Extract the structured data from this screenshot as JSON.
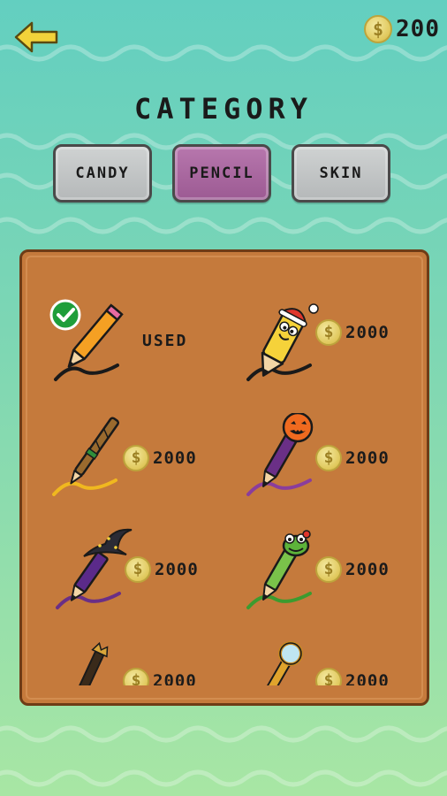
{
  "header": {
    "coin_symbol": "$",
    "coin_total": "200"
  },
  "title": "CATEGORY",
  "tabs": [
    {
      "label": "CANDY",
      "active": false
    },
    {
      "label": "PENCIL",
      "active": true
    },
    {
      "label": "SKIN",
      "active": false
    }
  ],
  "items": [
    {
      "icon": "orange-pencil-icon",
      "status": "USED",
      "selected": true
    },
    {
      "icon": "yellow-santa-pencil-icon",
      "price": "2000"
    },
    {
      "icon": "broom-pencil-icon",
      "price": "2000"
    },
    {
      "icon": "pumpkin-pencil-icon",
      "price": "2000"
    },
    {
      "icon": "witch-hat-pencil-icon",
      "price": "2000"
    },
    {
      "icon": "frog-pencil-icon",
      "price": "2000"
    },
    {
      "icon": "crown-brush-pencil-icon",
      "price": "2000"
    },
    {
      "icon": "magnifier-pencil-icon",
      "price": "2000"
    }
  ],
  "colors": {
    "panel": "#c57a3c",
    "tab_active": "#9c5a93",
    "tab_inactive": "#c2c5c6",
    "coin": "#e0c85c"
  }
}
